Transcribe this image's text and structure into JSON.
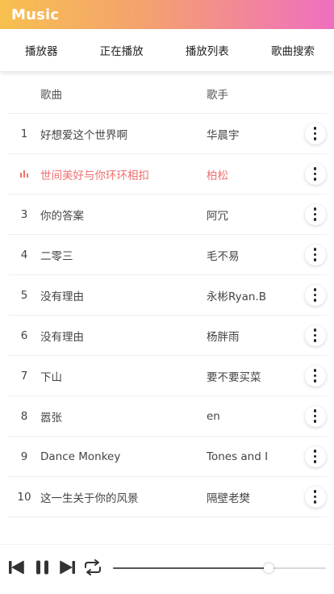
{
  "app": {
    "title": "Music"
  },
  "tabs": [
    "播放器",
    "正在播放",
    "播放列表",
    "歌曲搜索"
  ],
  "table": {
    "headers": {
      "song": "歌曲",
      "artist": "歌手"
    },
    "rows": [
      {
        "index": "1",
        "song": "好想爱这个世界啊",
        "artist": "华晨宇"
      },
      {
        "index": "",
        "song": "世间美好与你环环相扣",
        "artist": "柏松",
        "playing": true
      },
      {
        "index": "3",
        "song": "你的答案",
        "artist": "阿冗"
      },
      {
        "index": "4",
        "song": "二零三",
        "artist": "毛不易"
      },
      {
        "index": "5",
        "song": "没有理由",
        "artist": "永彬Ryan.B"
      },
      {
        "index": "6",
        "song": "没有理由",
        "artist": "杨胖雨"
      },
      {
        "index": "7",
        "song": "下山",
        "artist": "要不要买菜"
      },
      {
        "index": "8",
        "song": "嚣张",
        "artist": "en"
      },
      {
        "index": "9",
        "song": "Dance Monkey",
        "artist": "Tones and I"
      },
      {
        "index": "10",
        "song": "这一生关于你的风景",
        "artist": "隔壁老樊"
      }
    ]
  },
  "player": {
    "progress_fraction": 0.73,
    "controls": [
      "skip-previous-icon",
      "pause-icon",
      "skip-next-icon",
      "repeat-icon"
    ]
  },
  "colors": {
    "header_gradient": [
      "#f7c04f",
      "#f4a070",
      "#ef6fc0"
    ],
    "playing_accent": "#f07070"
  }
}
